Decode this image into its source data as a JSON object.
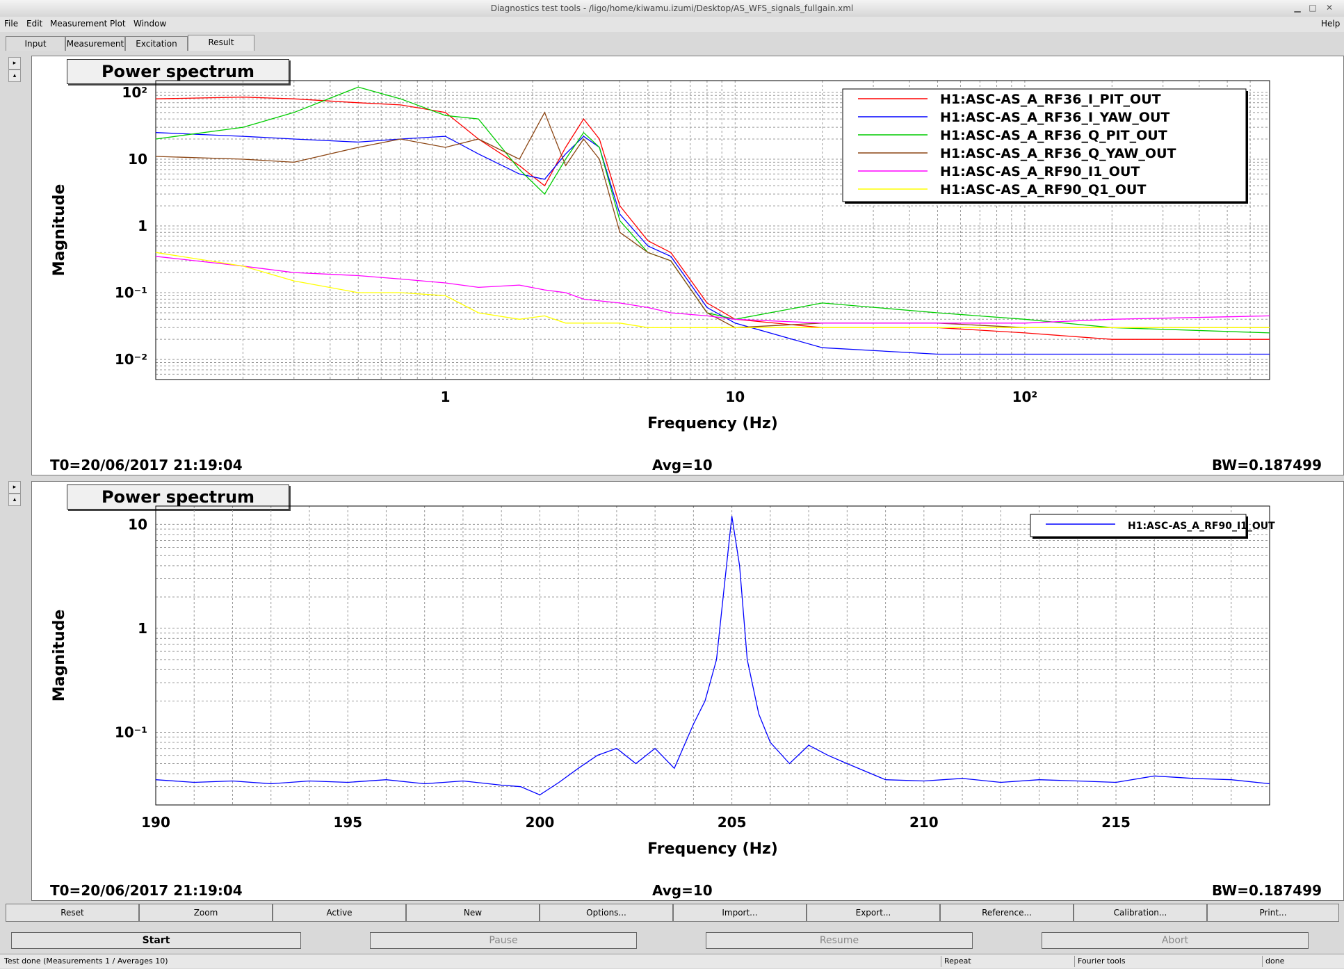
{
  "window": {
    "title": "Diagnostics test tools - /ligo/home/kiwamu.izumi/Desktop/AS_WFS_signals_fullgain.xml",
    "help": "Help"
  },
  "menu": [
    "File",
    "Edit",
    "Measurement",
    "Plot",
    "Window"
  ],
  "tabs": [
    "Input",
    "Measurement",
    "Excitation",
    "Result"
  ],
  "active_tab": "Result",
  "plots": [
    {
      "title": "Power spectrum",
      "t0": "T0=20/06/2017 21:19:04",
      "avg": "Avg=10",
      "bw": "BW=0.187499",
      "xlabel": "Frequency (Hz)",
      "ylabel": "Magnitude",
      "x_ticks": [
        "1",
        "10",
        "10²"
      ],
      "y_ticks": [
        "10²",
        "10",
        "1",
        "10⁻¹",
        "10⁻²"
      ]
    },
    {
      "title": "Power spectrum",
      "t0": "T0=20/06/2017 21:19:04",
      "avg": "Avg=10",
      "bw": "BW=0.187499",
      "xlabel": "Frequency (Hz)",
      "ylabel": "Magnitude",
      "x_ticks": [
        "190",
        "195",
        "200",
        "205",
        "210",
        "215"
      ],
      "y_ticks": [
        "10",
        "1",
        "10⁻¹"
      ]
    }
  ],
  "chart_data": [
    {
      "type": "line",
      "title": "Power spectrum",
      "xlabel": "Frequency (Hz)",
      "ylabel": "Magnitude",
      "xscale": "log",
      "yscale": "log",
      "xlim": [
        0.1,
        700
      ],
      "ylim": [
        0.005,
        150
      ],
      "grid": true,
      "legend": "top-right",
      "series": [
        {
          "name": "H1:ASC-AS_A_RF36_I_PIT_OUT",
          "color": "#ff0000",
          "x": [
            0.1,
            0.2,
            0.3,
            0.5,
            0.7,
            1.0,
            1.3,
            1.8,
            2.2,
            2.6,
            3.0,
            3.4,
            4.0,
            5.0,
            6.0,
            8.0,
            10,
            20,
            50,
            100,
            200,
            700
          ],
          "y": [
            80,
            85,
            80,
            70,
            65,
            50,
            20,
            8,
            4,
            15,
            40,
            20,
            2,
            0.6,
            0.4,
            0.07,
            0.04,
            0.03,
            0.03,
            0.025,
            0.02,
            0.02
          ]
        },
        {
          "name": "H1:ASC-AS_A_RF36_I_YAW_OUT",
          "color": "#0000ff",
          "x": [
            0.1,
            0.2,
            0.3,
            0.5,
            0.7,
            1.0,
            1.3,
            1.8,
            2.2,
            2.6,
            3.0,
            3.4,
            4.0,
            5.0,
            6.0,
            8.0,
            10,
            20,
            50,
            100,
            200,
            700
          ],
          "y": [
            25,
            22,
            20,
            18,
            20,
            22,
            12,
            6,
            5,
            12,
            22,
            15,
            1.5,
            0.5,
            0.35,
            0.06,
            0.035,
            0.015,
            0.012,
            0.012,
            0.012,
            0.012
          ]
        },
        {
          "name": "H1:ASC-AS_A_RF36_Q_PIT_OUT",
          "color": "#00cc00",
          "x": [
            0.1,
            0.2,
            0.3,
            0.5,
            0.7,
            1.0,
            1.3,
            1.8,
            2.2,
            2.6,
            3.0,
            3.4,
            4.0,
            5.0,
            6.0,
            8.0,
            10,
            20,
            50,
            100,
            200,
            700
          ],
          "y": [
            20,
            30,
            50,
            120,
            80,
            45,
            40,
            7,
            3,
            10,
            25,
            15,
            1.2,
            0.4,
            0.3,
            0.05,
            0.04,
            0.07,
            0.05,
            0.04,
            0.03,
            0.025
          ]
        },
        {
          "name": "H1:ASC-AS_A_RF36_Q_YAW_OUT",
          "color": "#8b4513",
          "x": [
            0.1,
            0.2,
            0.3,
            0.5,
            0.7,
            1.0,
            1.3,
            1.8,
            2.2,
            2.6,
            3.0,
            3.4,
            4.0,
            5.0,
            6.0,
            8.0,
            10,
            20,
            50,
            100,
            200,
            700
          ],
          "y": [
            11,
            10,
            9,
            15,
            20,
            15,
            20,
            10,
            50,
            8,
            20,
            10,
            0.8,
            0.4,
            0.3,
            0.05,
            0.03,
            0.035,
            0.035,
            0.03,
            0.03,
            0.03
          ]
        },
        {
          "name": "H1:ASC-AS_A_RF90_I1_OUT",
          "color": "#ff00ff",
          "x": [
            0.1,
            0.2,
            0.3,
            0.5,
            0.7,
            1.0,
            1.3,
            1.8,
            2.2,
            2.6,
            3.0,
            4.0,
            5.0,
            6.0,
            8.0,
            10,
            20,
            50,
            100,
            200,
            700
          ],
          "y": [
            0.35,
            0.25,
            0.2,
            0.18,
            0.16,
            0.14,
            0.12,
            0.13,
            0.11,
            0.1,
            0.08,
            0.07,
            0.06,
            0.05,
            0.045,
            0.04,
            0.035,
            0.035,
            0.035,
            0.04,
            0.045
          ]
        },
        {
          "name": "H1:ASC-AS_A_RF90_Q1_OUT",
          "color": "#ffff00",
          "x": [
            0.1,
            0.2,
            0.3,
            0.5,
            0.7,
            1.0,
            1.3,
            1.8,
            2.2,
            2.6,
            3.0,
            4.0,
            5.0,
            6.0,
            8.0,
            10,
            20,
            50,
            100,
            200,
            700
          ],
          "y": [
            0.4,
            0.25,
            0.15,
            0.1,
            0.1,
            0.09,
            0.05,
            0.04,
            0.045,
            0.035,
            0.035,
            0.035,
            0.03,
            0.03,
            0.03,
            0.03,
            0.03,
            0.03,
            0.03,
            0.03,
            0.03
          ]
        }
      ]
    },
    {
      "type": "line",
      "title": "Power spectrum",
      "xlabel": "Frequency (Hz)",
      "ylabel": "Magnitude",
      "xscale": "linear",
      "yscale": "log",
      "xlim": [
        190,
        219
      ],
      "ylim": [
        0.02,
        15
      ],
      "grid": true,
      "legend": "top-right",
      "series": [
        {
          "name": "H1:ASC-AS_A_RF90_I1_OUT",
          "color": "#0000ff",
          "x": [
            190,
            191,
            192,
            193,
            194,
            195,
            196,
            197,
            198,
            199,
            199.5,
            200,
            200.5,
            201,
            201.5,
            202,
            202.5,
            203,
            203.5,
            204,
            204.3,
            204.6,
            204.8,
            205,
            205.2,
            205.4,
            205.7,
            206,
            206.5,
            207,
            207.5,
            208,
            209,
            210,
            211,
            212,
            213,
            214,
            215,
            216,
            217,
            218,
            219
          ],
          "y": [
            0.035,
            0.033,
            0.034,
            0.032,
            0.034,
            0.033,
            0.035,
            0.032,
            0.034,
            0.031,
            0.03,
            0.025,
            0.033,
            0.045,
            0.06,
            0.07,
            0.05,
            0.07,
            0.045,
            0.12,
            0.2,
            0.5,
            2.5,
            12,
            4,
            0.5,
            0.15,
            0.08,
            0.05,
            0.075,
            0.06,
            0.05,
            0.035,
            0.034,
            0.036,
            0.033,
            0.035,
            0.034,
            0.033,
            0.038,
            0.036,
            0.035,
            0.032
          ]
        }
      ]
    }
  ],
  "toolbar": [
    "Reset",
    "Zoom",
    "Active",
    "New",
    "Options...",
    "Import...",
    "Export...",
    "Reference...",
    "Calibration...",
    "Print..."
  ],
  "controls": [
    "Start",
    "Pause",
    "Resume",
    "Abort"
  ],
  "status": {
    "message": "Test done (Measurements 1 / Averages 10)",
    "mode": "Repeat",
    "tool": "Fourier tools",
    "state": "done"
  }
}
